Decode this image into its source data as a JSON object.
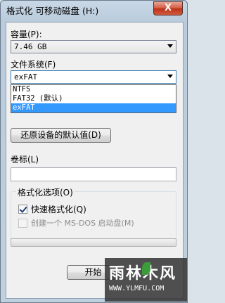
{
  "window": {
    "title": "格式化 可移动磁盘 (H:)",
    "close_label": "X"
  },
  "capacity": {
    "label": "容量(P):",
    "value": "7.46 GB"
  },
  "filesystem": {
    "label": "文件系统(F)",
    "value": "exFAT",
    "options": [
      {
        "label": "NTFS",
        "selected": false
      },
      {
        "label": "FAT32 (默认)",
        "selected": false
      },
      {
        "label": "exFAT",
        "selected": true
      }
    ]
  },
  "restore_defaults_label": "还原设备的默认值(D)",
  "volume_label": {
    "label": "卷标(L)",
    "value": ""
  },
  "format_options": {
    "title": "格式化选项(O)",
    "quick_format": {
      "label": "快速格式化(Q)",
      "checked": true
    },
    "msdos_disk": {
      "label": "创建一个 MS-DOS 启动盘(M)",
      "checked": false,
      "disabled": true
    }
  },
  "progress": 0,
  "start_button_label": "开始",
  "watermark": {
    "brand": "雨林木风",
    "url": "WWW.YLMFU.COM"
  }
}
